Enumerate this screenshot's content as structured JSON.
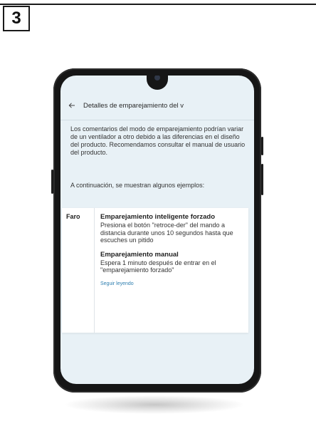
{
  "step": {
    "number": "3"
  },
  "screen": {
    "back_icon": "back-arrow-icon",
    "title": "Detalles de emparejamiento del v",
    "intro": "Los comentarios del modo de emparejamiento podrían variar de un ventilador a otro debido a las diferencias en el diseño del producto. Recomendamos consultar el manual de usuario del producto.",
    "examples_intro": "A continuación, se muestran algunos ejemplos:",
    "card": {
      "label": "Faro",
      "modes": [
        {
          "title": "Emparejamiento inteligente forzado",
          "text": "Presiona el botón \"retroce-der\" del mando a distancia durante unos 10 segundos hasta que escuches un pitido"
        },
        {
          "title": "Emparejamiento manual",
          "text": "Espera 1 minuto después de entrar en el \"emparejamiento forzado\""
        }
      ],
      "read_more": "Seguir leyendo"
    }
  }
}
